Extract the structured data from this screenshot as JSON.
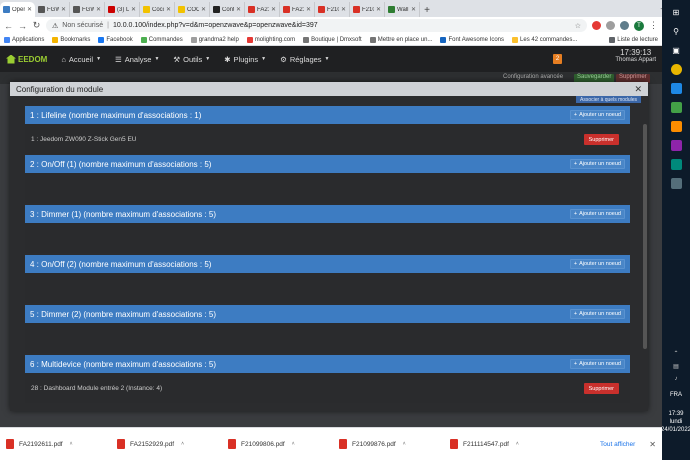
{
  "browser": {
    "tabs": [
      {
        "label": "Open",
        "color": "#3d7cc2",
        "active": true
      },
      {
        "label": "FGWI",
        "color": "#555555"
      },
      {
        "label": "FGWI",
        "color": "#555555"
      },
      {
        "label": "(3) Le",
        "color": "#cc0000"
      },
      {
        "label": "Coco",
        "color": "#f2c200"
      },
      {
        "label": "COCC",
        "color": "#f2c200"
      },
      {
        "label": "Conte",
        "color": "#222222"
      },
      {
        "label": "FA21",
        "color": "#d93025"
      },
      {
        "label": "FA21",
        "color": "#d93025"
      },
      {
        "label": "F2109",
        "color": "#d93025"
      },
      {
        "label": "F2109",
        "color": "#d93025"
      },
      {
        "label": "Wall",
        "color": "#2e7d32"
      }
    ],
    "url_insecure": "Non sécurisé",
    "url": "10.0.0.100/index.php?v=d&m=openzwave&p=openzwave&id=397",
    "avatar_letter": "T",
    "bookmarks": [
      {
        "label": "Applications",
        "color": "#4285f4"
      },
      {
        "label": "Bookmarks",
        "color": "#f4b400"
      },
      {
        "label": "Facebook",
        "color": "#1877f2"
      },
      {
        "label": "Commandes",
        "color": "#4caf50"
      },
      {
        "label": "grandma2 help",
        "color": "#9e9e9e"
      },
      {
        "label": "molighting.com",
        "color": "#e53935"
      },
      {
        "label": "Boutique | Dmxsoft",
        "color": "#757575"
      },
      {
        "label": "Mettre en place un...",
        "color": "#757575"
      },
      {
        "label": "Font Awesome Icons",
        "color": "#1565c0"
      },
      {
        "label": "Les 42 commandes...",
        "color": "#fbc02d"
      }
    ],
    "reading_list": "Liste de lecture"
  },
  "jeedom": {
    "logo": "EEDOM",
    "menu": [
      {
        "label": "Accueil"
      },
      {
        "label": "Analyse"
      },
      {
        "label": "Outils"
      },
      {
        "label": "Plugins"
      },
      {
        "label": "Réglages"
      }
    ],
    "notification_count": "2",
    "time": "17:39:13",
    "user": "Thomas Appart",
    "bg_buttons": [
      "Configuration avancée",
      "Sauvegarder",
      "Supprimer"
    ]
  },
  "modal": {
    "title": "Configuration du module",
    "associations_button": "Associer à quels modules",
    "groups": [
      {
        "title": "1 : Lifeline (nombre maximum d'associations : 1)",
        "add_label": "Ajouter un noeud",
        "nodes": [
          {
            "label": "1 : Jeedom ZW090 Z-Stick Gen5 EU",
            "delete_label": "Supprimer"
          }
        ]
      },
      {
        "title": "2 : On/Off (1) (nombre maximum d'associations : 5)",
        "add_label": "Ajouter un noeud",
        "nodes": []
      },
      {
        "title": "3 : Dimmer (1) (nombre maximum d'associations : 5)",
        "add_label": "Ajouter un noeud",
        "nodes": []
      },
      {
        "title": "4 : On/Off (2) (nombre maximum d'associations : 5)",
        "add_label": "Ajouter un noeud",
        "nodes": []
      },
      {
        "title": "5 : Dimmer (2) (nombre maximum d'associations : 5)",
        "add_label": "Ajouter un noeud",
        "nodes": []
      },
      {
        "title": "6 : Multidevice (nombre maximum d'associations : 5)",
        "add_label": "Ajouter un noeud",
        "nodes": [
          {
            "label": "28 : Dashboard Module entrée 2 (Instance: 4)",
            "delete_label": "Supprimer"
          }
        ]
      }
    ]
  },
  "downloads": {
    "files": [
      "FA2192611.pdf",
      "FA2152929.pdf",
      "F21099806.pdf",
      "F21099876.pdf",
      "F211114547.pdf"
    ],
    "show_all": "Tout afficher"
  },
  "taskbar": {
    "language": "FRA",
    "time": "17:39",
    "day": "lundi",
    "date": "24/01/2022"
  }
}
